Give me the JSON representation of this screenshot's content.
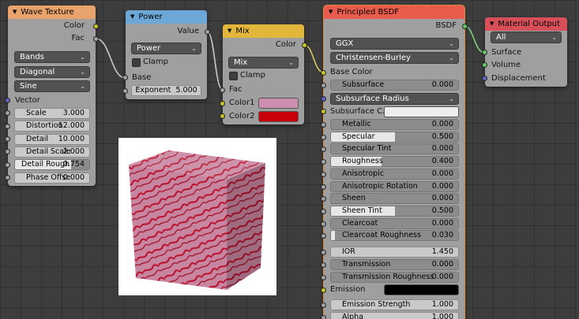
{
  "wave": {
    "title": "Wave Texture",
    "out_color": "Color",
    "out_fac": "Fac",
    "type": "Bands",
    "direction": "Diagonal",
    "profile": "Sine",
    "vector": "Vector",
    "fields": [
      {
        "label": "Scale",
        "value": "3.000"
      },
      {
        "label": "Distortion",
        "value": "12.000"
      },
      {
        "label": "Detail",
        "value": "10.000"
      },
      {
        "label": "Detail Scale",
        "value": "2.000"
      },
      {
        "label": "Detail Rough",
        "value": "0.754",
        "fill": 0.754
      },
      {
        "label": "Phase Offse",
        "value": "0.000"
      }
    ]
  },
  "power": {
    "title": "Power",
    "out_value": "Value",
    "operation": "Power",
    "clamp": "Clamp",
    "in_base": "Base",
    "exponent": "Exponent",
    "exponent_value": "5.000"
  },
  "mix": {
    "title": "Mix",
    "out_color": "Color",
    "blend": "Mix",
    "clamp": "Clamp",
    "in_fac": "Fac",
    "color1": "Color1",
    "color2": "Color2",
    "color1_hex": "#cc8eb0",
    "color2_hex": "#c8000a"
  },
  "bsdf": {
    "title": "Principled BSDF",
    "out": "BSDF",
    "distribution": "GGX",
    "subsurface_method": "Christensen-Burley",
    "base_color": "Base Color",
    "subsurface": {
      "label": "Subsurface",
      "value": "0.000"
    },
    "subsurface_radius": "Subsurface Radius",
    "subsurface_color": "Subsurface C...",
    "subsurface_color_hex": "#ededed",
    "fields": [
      {
        "label": "Metallic",
        "value": "0.000",
        "fill": 0.0
      },
      {
        "label": "Specular",
        "value": "0.500",
        "fill": 0.5
      },
      {
        "label": "Specular Tint",
        "value": "0.000",
        "fill": 0.0
      },
      {
        "label": "Roughness",
        "value": "0.400",
        "fill": 0.4
      },
      {
        "label": "Anisotropic",
        "value": "0.000",
        "fill": 0.0
      },
      {
        "label": "Anisotropic Rotation",
        "value": "0.000",
        "fill": 0.0
      },
      {
        "label": "Sheen",
        "value": "0.000",
        "fill": 0.0
      },
      {
        "label": "Sheen Tint",
        "value": "0.500",
        "fill": 0.5
      },
      {
        "label": "Clearcoat",
        "value": "0.000",
        "fill": 0.0
      },
      {
        "label": "Clearcoat Roughness",
        "value": "0.030",
        "fill": 0.03
      }
    ],
    "ior": {
      "label": "IOR",
      "value": "1.450"
    },
    "transmission": {
      "label": "Transmission",
      "value": "0.000"
    },
    "transmission_roughness": {
      "label": "Transmission Roughness",
      "value": "0.000"
    },
    "emission": "Emission",
    "emission_hex": "#000000",
    "emission_strength": {
      "label": "Emission Strength",
      "value": "1.000"
    },
    "alpha": {
      "label": "Alpha",
      "value": "1.000"
    }
  },
  "output": {
    "title": "Material Output",
    "target": "All",
    "surface": "Surface",
    "volume": "Volume",
    "displacement": "Displacement"
  },
  "colors": {
    "tex_header": "#e8a26c",
    "shader_header": "#e85b4d",
    "socket_color": "#c7c729",
    "socket_value": "#a1a1a1",
    "socket_vector": "#6363c7",
    "socket_shader": "#63c763"
  }
}
